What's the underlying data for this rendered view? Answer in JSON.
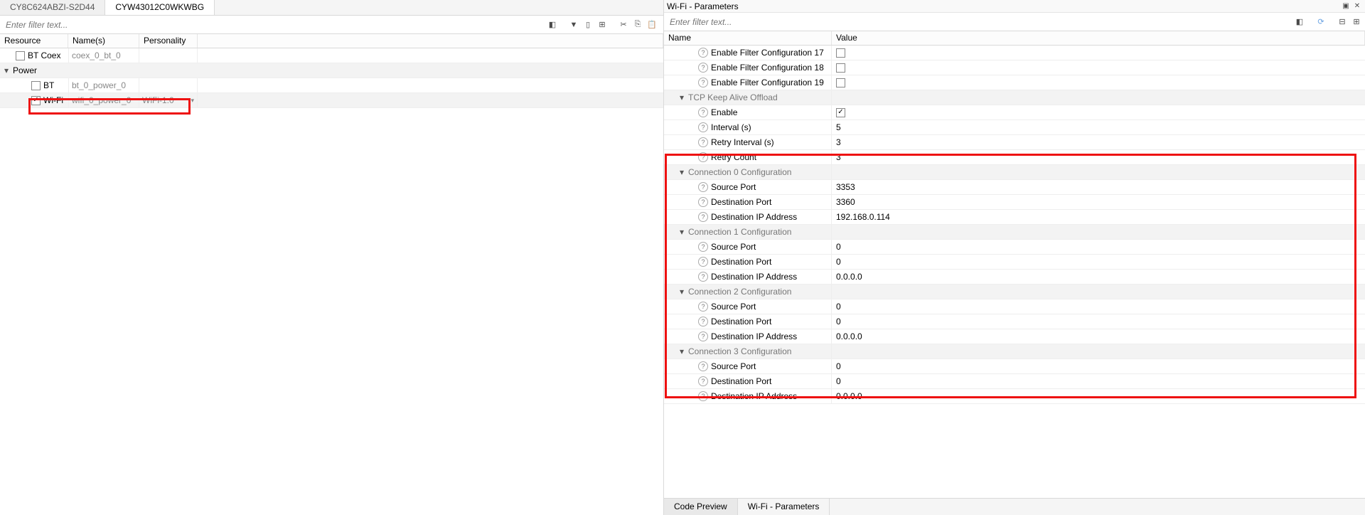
{
  "left": {
    "tabs": [
      "CY8C624ABZI-S2D44",
      "CYW43012C0WKWBG"
    ],
    "active_tab": 1,
    "filter_placeholder": "Enter filter text...",
    "columns": {
      "resource": "Resource",
      "names": "Name(s)",
      "personality": "Personality"
    },
    "rows": [
      {
        "type": "item",
        "indent": 1,
        "checked": false,
        "label": "BT Coex",
        "names": "coex_0_bt_0",
        "pers": ""
      },
      {
        "type": "group",
        "indent": 0,
        "label": "Power"
      },
      {
        "type": "item",
        "indent": 2,
        "checked": false,
        "label": "BT",
        "names": "bt_0_power_0",
        "pers": ""
      },
      {
        "type": "item",
        "indent": 2,
        "checked": true,
        "label": "Wi-Fi",
        "names": "wifi_0_power_0",
        "pers": "WiFi-1.0",
        "selected": true
      }
    ]
  },
  "right": {
    "title": "Wi-Fi - Parameters",
    "filter_placeholder": "Enter filter text...",
    "columns": {
      "name": "Name",
      "value": "Value"
    },
    "params": [
      {
        "t": "p",
        "ind": "b",
        "label": "Enable Filter Configuration 17",
        "vtype": "check",
        "v": false
      },
      {
        "t": "p",
        "ind": "b",
        "label": "Enable Filter Configuration 18",
        "vtype": "check",
        "v": false
      },
      {
        "t": "p",
        "ind": "b",
        "label": "Enable Filter Configuration 19",
        "vtype": "check",
        "v": false
      },
      {
        "t": "g",
        "ind": "a",
        "label": "TCP Keep Alive Offload"
      },
      {
        "t": "p",
        "ind": "b",
        "label": "Enable",
        "vtype": "check",
        "v": true
      },
      {
        "t": "p",
        "ind": "b",
        "label": "Interval (s)",
        "vtype": "text",
        "v": "5"
      },
      {
        "t": "p",
        "ind": "b",
        "label": "Retry Interval (s)",
        "vtype": "text",
        "v": "3"
      },
      {
        "t": "p",
        "ind": "b",
        "label": "Retry Count",
        "vtype": "text",
        "v": "3"
      },
      {
        "t": "g",
        "ind": "a",
        "label": "Connection 0 Configuration"
      },
      {
        "t": "p",
        "ind": "b",
        "label": "Source Port",
        "vtype": "text",
        "v": "3353"
      },
      {
        "t": "p",
        "ind": "b",
        "label": "Destination Port",
        "vtype": "text",
        "v": "3360"
      },
      {
        "t": "p",
        "ind": "b",
        "label": "Destination IP Address",
        "vtype": "text",
        "v": "192.168.0.114"
      },
      {
        "t": "g",
        "ind": "a",
        "label": "Connection 1 Configuration"
      },
      {
        "t": "p",
        "ind": "b",
        "label": "Source Port",
        "vtype": "text",
        "v": "0"
      },
      {
        "t": "p",
        "ind": "b",
        "label": "Destination Port",
        "vtype": "text",
        "v": "0"
      },
      {
        "t": "p",
        "ind": "b",
        "label": "Destination IP Address",
        "vtype": "text",
        "v": "0.0.0.0"
      },
      {
        "t": "g",
        "ind": "a",
        "label": "Connection 2 Configuration"
      },
      {
        "t": "p",
        "ind": "b",
        "label": "Source Port",
        "vtype": "text",
        "v": "0"
      },
      {
        "t": "p",
        "ind": "b",
        "label": "Destination Port",
        "vtype": "text",
        "v": "0"
      },
      {
        "t": "p",
        "ind": "b",
        "label": "Destination IP Address",
        "vtype": "text",
        "v": "0.0.0.0"
      },
      {
        "t": "g",
        "ind": "a",
        "label": "Connection 3 Configuration"
      },
      {
        "t": "p",
        "ind": "b",
        "label": "Source Port",
        "vtype": "text",
        "v": "0"
      },
      {
        "t": "p",
        "ind": "b",
        "label": "Destination Port",
        "vtype": "text",
        "v": "0"
      },
      {
        "t": "p",
        "ind": "b",
        "label": "Destination IP Address",
        "vtype": "text",
        "v": "0.0.0.0"
      }
    ],
    "bottom_tabs": [
      "Code Preview",
      "Wi-Fi - Parameters"
    ],
    "bottom_active": 0
  },
  "icons": {
    "eraser": "◧",
    "filter": "▼",
    "col": "▯",
    "exp": "⊞",
    "cut": "✂",
    "copy": "⎘",
    "paste": "📋",
    "refresh": "⟳",
    "collapse": "⊟",
    "expand": "⊞",
    "max": "▣",
    "close": "✕"
  }
}
